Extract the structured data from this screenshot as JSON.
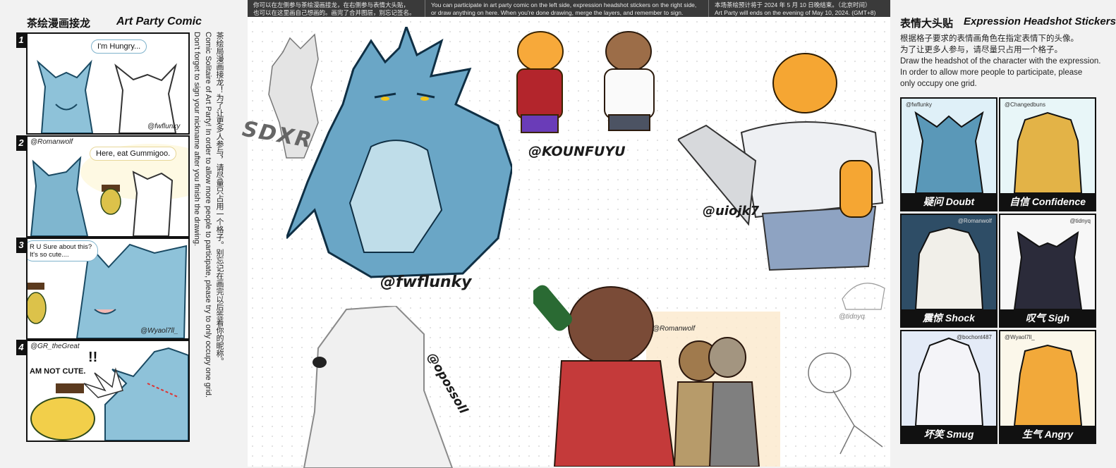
{
  "banner": {
    "col1_line1": "你可以在左侧参与茶绘漫画接龙，在右侧参与表情大头贴，",
    "col1_line2": "也可以在这里画自己想画的。画完了合并图层，别忘记签名。",
    "col2_line1": "You can participate in art party comic on the left side, expression headshot stickers on the right side,",
    "col2_line2": "or draw anything on here. When you're done drawing, merge the layers, and remember to sign.",
    "col3_line1": "本场茶绘预计将于 2024 年 5 月 10 日晚结束。（北京时间）",
    "col3_line2": "Art Party will ends on the evening of May 10, 2024. (GMT+8)"
  },
  "left": {
    "title_cn": "茶绘漫画接龙",
    "title_en": "Art Party Comic",
    "panels": [
      {
        "num": "1",
        "bubble": "I'm Hungry...",
        "sig_bottom": "@fwflunky"
      },
      {
        "num": "2",
        "bubble": "Here, eat Gummigoo.",
        "sig_top": "@Romanwolf"
      },
      {
        "num": "3",
        "bubble_line1": "R U Sure about this?",
        "bubble_line2": "It's so cute....",
        "sig_bottom": "@Wyaol7ll_"
      },
      {
        "num": "4",
        "sig_top": "@GR_theGreat",
        "text1": "AM NOT CUTE.",
        "text2": "!!"
      }
    ],
    "instructions_cn": "茶绘局漫画接龙！为了让更多人参与，请尽量只占用一个格子。别忘记在画完以后签着你的昵称。",
    "instructions_en1": "Comic Solitaire of Art Party! In order to allow more people to participate, please try to only occupy one grid.",
    "instructions_en2": "Don't forget to sign your nickname after you finish the drawing."
  },
  "canvas": {
    "handles": [
      "@fwflunky",
      "@KOUNFUYU",
      "@uiojk7",
      "@opossoll",
      "@Romanwolf",
      "@tidnyq",
      "SDXR"
    ]
  },
  "right": {
    "title_cn": "表情大头贴",
    "title_en": "Expression Headshot Stickers",
    "desc_cn1": "根据格子要求的表情画角色在指定表情下的头像。",
    "desc_cn2": "为了让更多人参与，请尽量只占用一个格子。",
    "desc_en1": "Draw the headshot of the character with the expression.",
    "desc_en2": "In order to allow more people to participate, please",
    "desc_en3": "only occupy one grid.",
    "stickers": [
      {
        "label": "疑问 Doubt",
        "tag": "@fwflunky",
        "bg": "#dff0f8",
        "fur": "#5a98b8"
      },
      {
        "label": "自信 Confidence",
        "tag": "@Changedbuns",
        "bg": "#e8f6f8",
        "fur": "#e3b347"
      },
      {
        "label": "震惊 Shock",
        "tag": "@Romanwolf",
        "bg": "#2e4d66",
        "fur": "#f1efe9"
      },
      {
        "label": "叹气 Sigh",
        "tag": "@tidnyq",
        "bg": "#f7f7f7",
        "fur": "#2b2b3a"
      },
      {
        "label": "坏笑 Smug",
        "tag": "@bochont487",
        "bg": "#e4ebf7",
        "fur": "#f4f4f8"
      },
      {
        "label": "生气 Angry",
        "tag": "@Wyaol7ll_",
        "bg": "#fbf7ea",
        "fur": "#f2a93a"
      }
    ]
  }
}
